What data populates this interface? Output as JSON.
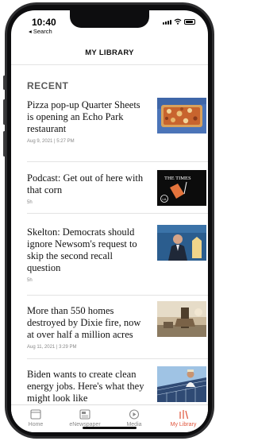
{
  "status_bar": {
    "time": "10:40",
    "back_label": "◂ Search"
  },
  "header": {
    "title": "MY LIBRARY"
  },
  "section": {
    "title": "RECENT"
  },
  "articles": [
    {
      "headline": "Pizza pop-up Quarter Sheets is opening an Echo Park restaurant",
      "meta": "Aug 9, 2021 | 5:27 PM",
      "thumbnail": "pizza-photo"
    },
    {
      "headline": "Podcast: Get out of here with that corn",
      "meta": "5h",
      "thumbnail": "the-times-podcast-art",
      "thumb_text": "THE TIMES"
    },
    {
      "headline": "Skelton: Democrats should ignore Newsom's request to skip the second recall question",
      "meta": "5h",
      "thumbnail": "newsom-photo"
    },
    {
      "headline": "More than 550 homes destroyed by Dixie fire, now at over half a million acres",
      "meta": "Aug 11, 2021 | 3:29 PM",
      "thumbnail": "fire-photo"
    },
    {
      "headline": "Biden wants to create clean energy jobs. Here's what they might look like",
      "meta": "",
      "thumbnail": "solar-worker-photo"
    }
  ],
  "tabs": [
    {
      "label": "Home",
      "icon": "home-icon",
      "active": false
    },
    {
      "label": "eNewspaper",
      "icon": "newspaper-icon",
      "active": false
    },
    {
      "label": "Media",
      "icon": "media-play-icon",
      "active": false
    },
    {
      "label": "My Library",
      "icon": "library-icon",
      "active": true
    }
  ],
  "colors": {
    "accent": "#e0533a",
    "inactive": "#8a8a8a",
    "text": "#111111",
    "meta": "#888888"
  }
}
